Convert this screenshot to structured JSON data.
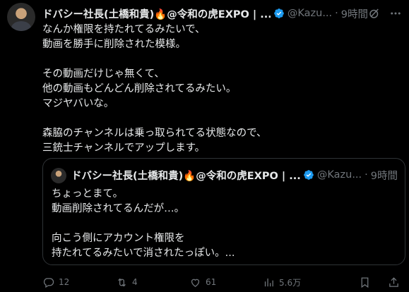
{
  "post": {
    "author": "ドバシー社長(土橋和貴)🔥@令和の虎EXPO | ...",
    "handle": "@Kazu...",
    "separator": "·",
    "time": "9時間",
    "lines": [
      "なんか権限を持たれてるみたいで、",
      "動画を勝手に削除された模様。",
      "",
      "その動画だけじゃ無くて、",
      "他の動画もどんどん削除されてるみたい。",
      "マジヤバいな。",
      "",
      "森脇のチャンネルは乗っ取られてる状態なので、",
      "三銃士チャンネルでアップします。"
    ]
  },
  "quote": {
    "author": "ドバシー社長(土橋和貴)🔥@令和の虎EXPO | ...",
    "handle": "@Kazu...",
    "separator": "·",
    "time": "9時間",
    "lines": [
      "ちょっとまて。",
      "動画削除されてるんだが…。",
      "",
      "向こう側にアカウント権限を",
      "持たれてるみたいで消されたっぽい。..."
    ]
  },
  "actions": {
    "replies": "12",
    "reposts": "4",
    "likes": "61",
    "views": "5.6万"
  },
  "colors": {
    "background": "#000000",
    "text": "#e7e9ea",
    "muted": "#71767b",
    "verified": "#1d9bf0",
    "border": "#2f3336"
  },
  "icons": [
    "verified-badge-icon",
    "grok-icon",
    "more-icon",
    "reply-icon",
    "repost-icon",
    "like-icon",
    "views-icon",
    "bookmark-icon",
    "share-icon"
  ]
}
